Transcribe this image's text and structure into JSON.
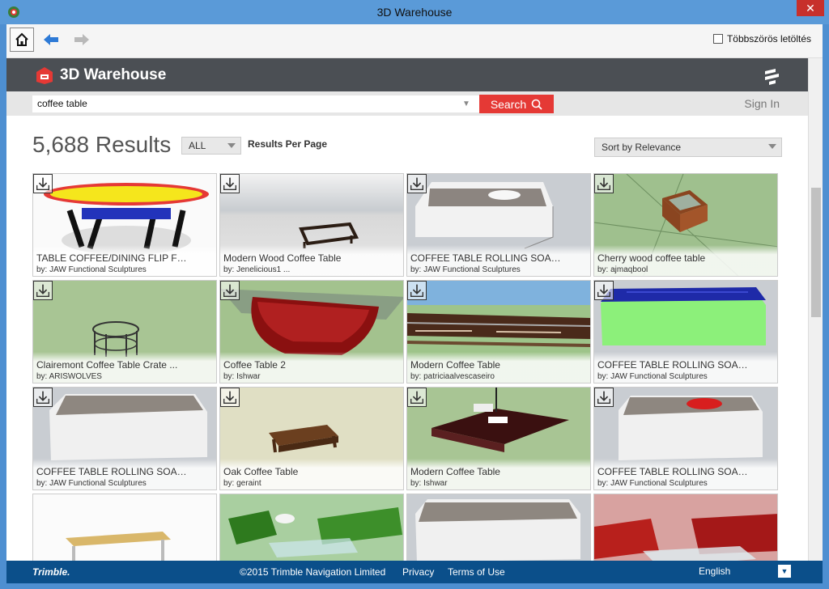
{
  "window": {
    "title": "3D Warehouse",
    "close_label": "✕"
  },
  "toolbar": {
    "multi_download_label": "Többszörös letöltés"
  },
  "header": {
    "brand": "3D Warehouse"
  },
  "search": {
    "value": "coffee table",
    "button_label": "Search",
    "sign_in": "Sign In"
  },
  "results": {
    "count_label": "5,688 Results",
    "filter_value": "ALL",
    "per_page_label": "Results Per Page",
    "sort_value": "Sort by Relevance"
  },
  "items": [
    {
      "name": "TABLE COFFEE/DINING FLIP FL...",
      "author": "by: JAW Functional Sculptures"
    },
    {
      "name": "Modern Wood Coffee Table",
      "author": "by: Jenelicious1 ..."
    },
    {
      "name": "COFFEE TABLE ROLLING SOAP ...",
      "author": "by: JAW Functional Sculptures"
    },
    {
      "name": "Cherry wood coffee table",
      "author": "by: ajmaqbool"
    },
    {
      "name": "Clairemont Coffee Table Crate ...",
      "author": "by: ARISWOLVES"
    },
    {
      "name": "Coffee Table 2",
      "author": "by: Ishwar"
    },
    {
      "name": "Modern Coffee Table",
      "author": "by: patriciaalvescaseiro"
    },
    {
      "name": "COFFEE TABLE ROLLING SOAP ...",
      "author": "by: JAW Functional Sculptures"
    },
    {
      "name": "COFFEE TABLE ROLLING SOAP ...",
      "author": "by: JAW Functional Sculptures"
    },
    {
      "name": "Oak Coffee Table",
      "author": "by: geraint"
    },
    {
      "name": "Modern Coffee Table",
      "author": "by: Ishwar"
    },
    {
      "name": "COFFEE TABLE ROLLING SOAP ...",
      "author": "by: JAW Functional Sculptures"
    },
    {
      "name": "",
      "author": ""
    },
    {
      "name": "",
      "author": ""
    },
    {
      "name": "",
      "author": ""
    },
    {
      "name": "",
      "author": ""
    }
  ],
  "footer": {
    "logo": "Trimble.",
    "copyright": "©2015 Trimble Navigation Limited",
    "privacy": "Privacy",
    "terms": "Terms of Use",
    "language": "English"
  }
}
